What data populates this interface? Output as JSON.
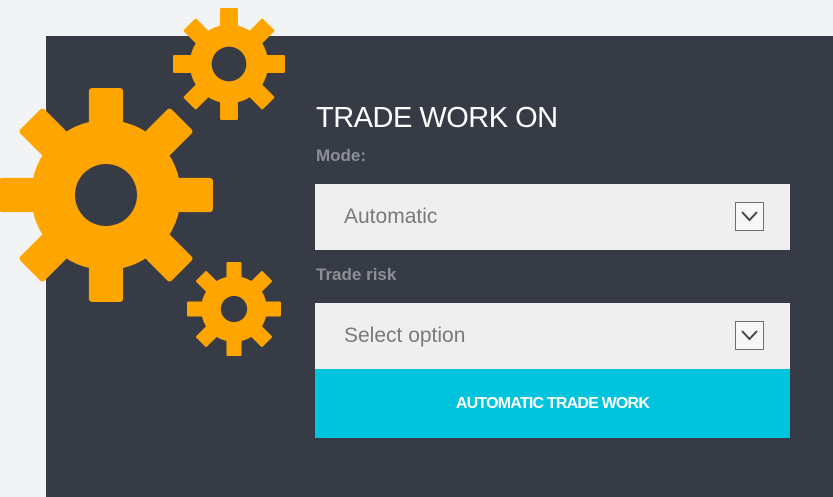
{
  "panel": {
    "title": "TRADE WORK ON",
    "mode": {
      "label": "Mode:",
      "value": "Automatic",
      "icon": "chevron-down-icon"
    },
    "trade_risk": {
      "label": "Trade risk",
      "value": "Select option",
      "icon": "chevron-down-icon"
    },
    "action_button_label": "AUTOMATIC TRADE WORK"
  },
  "decoration": {
    "icon": "gears-icon"
  },
  "colors": {
    "page_background": "#f2f3f4",
    "panel_background": "#373b45",
    "gear": "#ffa500",
    "accent_button": "#00c3de",
    "select_background": "#efefef",
    "label_text": "#8b8f96",
    "select_text": "#7a7a7a"
  }
}
